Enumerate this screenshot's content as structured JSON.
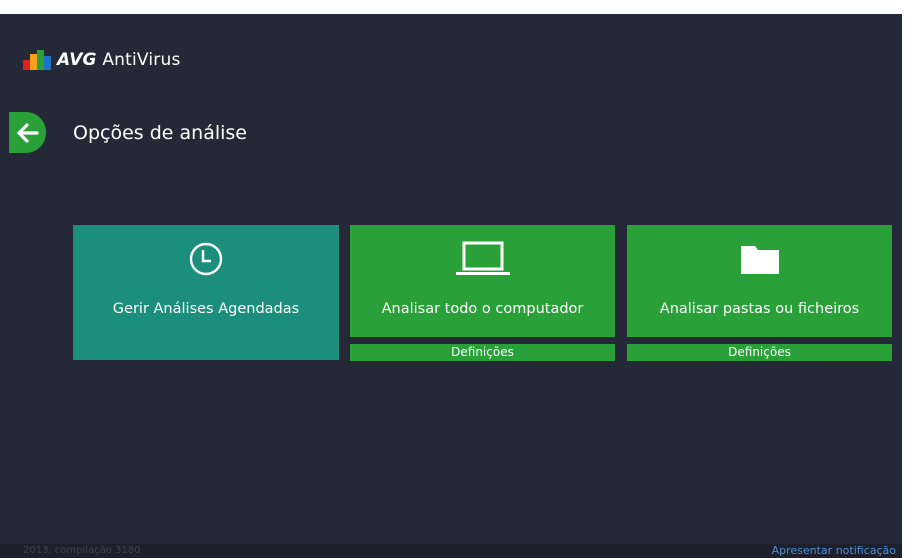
{
  "window": {
    "minimize_icon": "minimize-icon",
    "close_label": "×"
  },
  "brand": {
    "name_bold": "AVG",
    "name_rest": "AntiVirus",
    "logo_colors": [
      "#e0201b",
      "#f7a01a",
      "#2aa038",
      "#1f73c6"
    ]
  },
  "page": {
    "back_icon": "arrow-left-icon",
    "title": "Opções de análise"
  },
  "tiles": [
    {
      "label": "Gerir Análises Agendadas",
      "icon": "clock-icon",
      "color": "#1b8f7c"
    },
    {
      "label": "Analisar todo o computador",
      "icon": "laptop-icon",
      "color": "#2aa038",
      "settings_label": "Definições"
    },
    {
      "label": "Analisar pastas ou ficheiros",
      "icon": "folder-icon",
      "color": "#2aa038",
      "settings_label": "Definições"
    }
  ],
  "footer": {
    "version": "2013, compilação 3180",
    "notification_link": "Apresentar notificação"
  },
  "colors": {
    "background": "#252937",
    "accent_green": "#2aa038",
    "teal": "#1b8f7c",
    "link": "#4f8fd8"
  }
}
